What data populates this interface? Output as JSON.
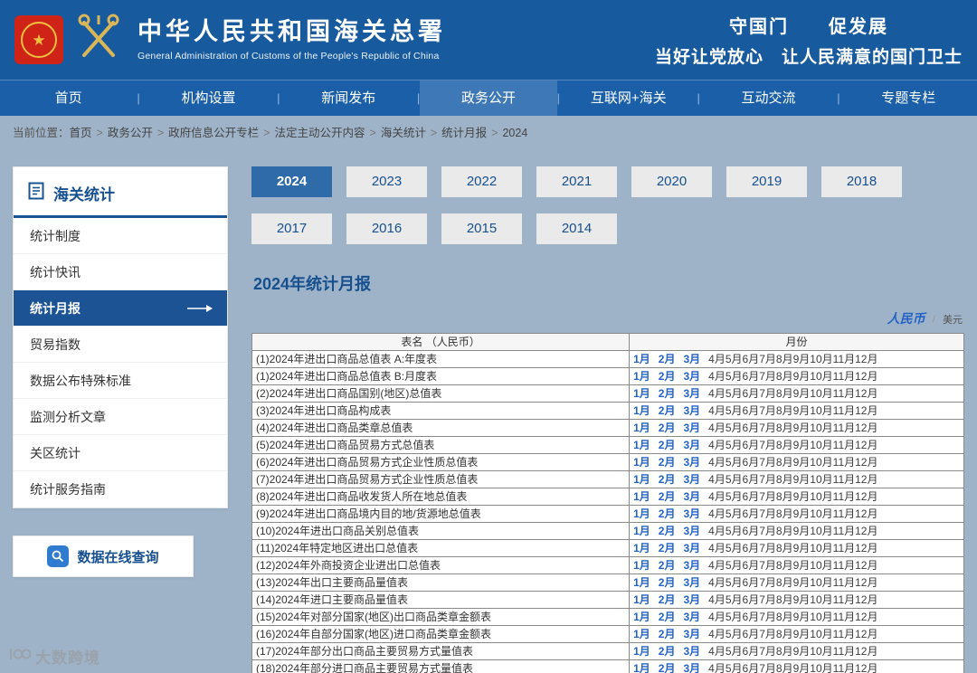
{
  "header": {
    "title": "中华人民共和国海关总署",
    "subtitle": "General Administration of Customs of the People's Republic of China",
    "slogan_line1": "守国门　　促发展",
    "slogan_line2": "当好让党放心　让人民满意的国门卫士"
  },
  "nav": {
    "separator": "|",
    "items": [
      {
        "label": "首页",
        "active": false
      },
      {
        "label": "机构设置",
        "active": false
      },
      {
        "label": "新闻发布",
        "active": false
      },
      {
        "label": "政务公开",
        "active": true
      },
      {
        "label": "互联网+海关",
        "active": false
      },
      {
        "label": "互动交流",
        "active": false
      },
      {
        "label": "专题专栏",
        "active": false
      }
    ]
  },
  "breadcrumb": {
    "label": "当前位置：",
    "separator": ">",
    "items": [
      "首页",
      "政务公开",
      "政府信息公开专栏",
      "法定主动公开内容",
      "海关统计",
      "统计月报",
      "2024"
    ]
  },
  "sidebar": {
    "title": "海关统计",
    "items": [
      {
        "label": "统计制度",
        "active": false
      },
      {
        "label": "统计快讯",
        "active": false
      },
      {
        "label": "统计月报",
        "active": true
      },
      {
        "label": "贸易指数",
        "active": false
      },
      {
        "label": "数据公布特殊标准",
        "active": false
      },
      {
        "label": "监测分析文章",
        "active": false
      },
      {
        "label": "关区统计",
        "active": false
      },
      {
        "label": "统计服务指南",
        "active": false
      }
    ],
    "query_button_label": "数据在线查询"
  },
  "main": {
    "active_year": "2024",
    "years": [
      "2024",
      "2023",
      "2022",
      "2021",
      "2020",
      "2019",
      "2018",
      "2017",
      "2016",
      "2015",
      "2014"
    ],
    "page_title": "2024年统计月报",
    "currency": {
      "rmb": "人民币",
      "separator": "/",
      "usd": "美元"
    },
    "table": {
      "headers": {
        "name": "表名 （人民币）",
        "months": "月份"
      },
      "months": [
        {
          "label": "1月",
          "linked": true
        },
        {
          "label": "2月",
          "linked": true
        },
        {
          "label": "3月",
          "linked": true
        },
        {
          "label": "4月",
          "linked": false
        },
        {
          "label": "5月",
          "linked": false
        },
        {
          "label": "6月",
          "linked": false
        },
        {
          "label": "7月",
          "linked": false
        },
        {
          "label": "8月",
          "linked": false
        },
        {
          "label": "9月",
          "linked": false
        },
        {
          "label": "10月",
          "linked": false
        },
        {
          "label": "11月",
          "linked": false
        },
        {
          "label": "12月",
          "linked": false
        }
      ],
      "rows": [
        "(1)2024年进出口商品总值表 A:年度表",
        "(1)2024年进出口商品总值表 B:月度表",
        "(2)2024年进出口商品国别(地区)总值表",
        "(3)2024年进出口商品构成表",
        "(4)2024年进出口商品类章总值表",
        "(5)2024年进出口商品贸易方式总值表",
        "(6)2024年进出口商品贸易方式企业性质总值表",
        "(7)2024年进出口商品贸易方式企业性质总值表",
        "(8)2024年进出口商品收发货人所在地总值表",
        "(9)2024年进出口商品境内目的地/货源地总值表",
        "(10)2024年进出口商品关别总值表",
        "(11)2024年特定地区进出口总值表",
        "(12)2024年外商投资企业进出口总值表",
        "(13)2024年出口主要商品量值表",
        "(14)2024年进口主要商品量值表",
        "(15)2024年对部分国家(地区)出口商品类章金额表",
        "(16)2024年自部分国家(地区)进口商品类章金额表",
        "(17)2024年部分出口商品主要贸易方式量值表",
        "(18)2024年部分进口商品主要贸易方式量值表"
      ]
    }
  },
  "watermark": {
    "text": "大数跨境"
  },
  "colors": {
    "header_blue": "#175a9d",
    "nav_blue": "#1a5fa8",
    "sidebar_active_blue": "#1b5394",
    "tab_active_blue": "#2e6ba8",
    "link_blue": "#2363c4",
    "emblem_red": "#cf2318",
    "gold": "#f0c040"
  }
}
